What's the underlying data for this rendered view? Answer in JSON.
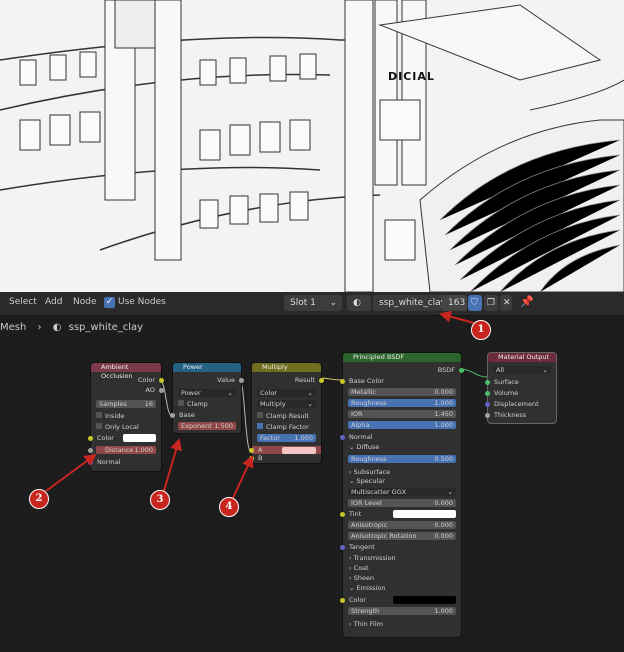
{
  "header": {
    "menu": [
      "Select",
      "Add",
      "Node"
    ],
    "use_nodes_label": "Use Nodes",
    "slot": "Slot 1",
    "material_name": "ssp_white_clay",
    "user_count": "163"
  },
  "breadcrumb": {
    "object": "Mesh",
    "material": "ssp_white_clay"
  },
  "viewport_sign": "DICIAL",
  "nodes": {
    "ao": {
      "title": "Ambient Occlusion",
      "out_color": "Color",
      "out_ao": "AO",
      "samples_label": "Samples",
      "samples_value": "16",
      "inside": "Inside",
      "only_local": "Only Local",
      "color": "Color",
      "distance_label": "Distance",
      "distance_value": "1.000",
      "normal": "Normal"
    },
    "power": {
      "title": "Power",
      "out": "Value",
      "op": "Power",
      "clamp": "Clamp",
      "base": "Base",
      "exponent_label": "Exponent",
      "exponent_value": "1.500"
    },
    "multiply": {
      "title": "Multiply",
      "out": "Result",
      "type": "Color",
      "blend": "Multiply",
      "clamp_result": "Clamp Result",
      "clamp_factor": "Clamp Factor",
      "factor_label": "Factor",
      "factor_value": "1.000",
      "a": "A",
      "b": "B"
    },
    "bsdf": {
      "title": "Principled BSDF",
      "out": "BSDF",
      "base_color": "Base Color",
      "metallic_label": "Metallic",
      "metallic_value": "0.000",
      "roughness_label": "Roughness",
      "roughness_value": "1.000",
      "ior_label": "IOR",
      "ior_value": "1.450",
      "alpha_label": "Alpha",
      "alpha_value": "1.000",
      "normal": "Normal",
      "diffuse": "Diffuse",
      "roughness2_label": "Roughness",
      "roughness2_value": "0.500",
      "subsurface": "Subsurface",
      "specular": "Specular",
      "distribution": "Multiscatter GGX",
      "ior_level_label": "IOR Level",
      "ior_level_value": "0.000",
      "tint": "Tint",
      "anisotropic_label": "Anisotropic",
      "anisotropic_value": "0.000",
      "aniso_rot_label": "Anisotropic Rotation",
      "aniso_rot_value": "0.000",
      "tangent": "Tangent",
      "transmission": "Transmission",
      "coat": "Coat",
      "sheen": "Sheen",
      "emission": "Emission",
      "color": "Color",
      "strength_label": "Strength",
      "strength_value": "1.000",
      "thin_film": "Thin Film"
    },
    "output": {
      "title": "Material Output",
      "target": "All",
      "surface": "Surface",
      "volume": "Volume",
      "displacement": "Displacement",
      "thickness": "Thickness"
    }
  },
  "annotations": [
    "1",
    "2",
    "3",
    "4"
  ],
  "colors": {
    "ao_header": "#7a3a4a",
    "power_header": "#246283",
    "multiply_header": "#6e6e1e",
    "bsdf_header": "#2b652b",
    "output_header": "#6f2b3e",
    "annotation": "#c8251f"
  }
}
